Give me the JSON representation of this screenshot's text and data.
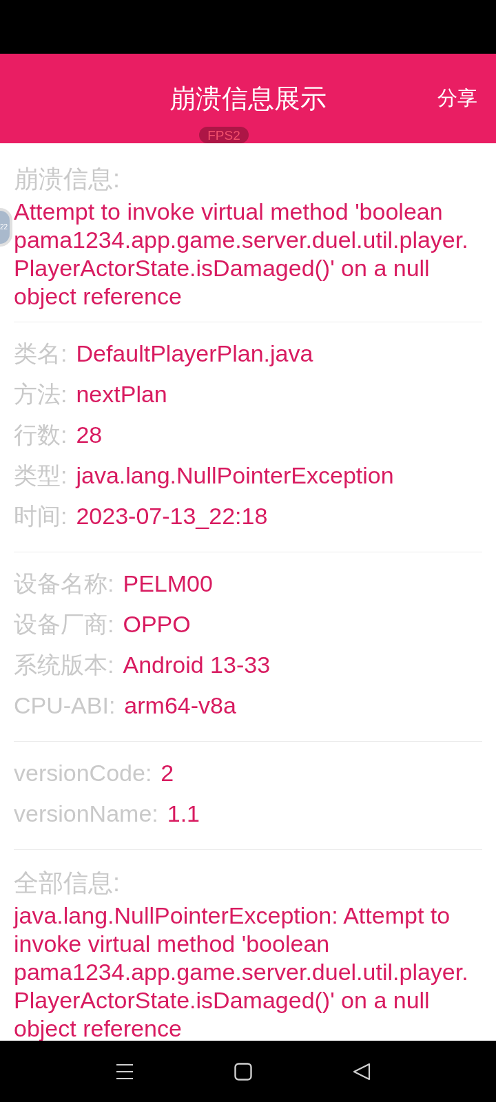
{
  "header": {
    "title": "崩溃信息展示",
    "action": "分享"
  },
  "fps_badge": "FPS2",
  "floating_ball": {
    "text": "22"
  },
  "crash_info": {
    "heading": "崩溃信息:",
    "text": "Attempt to invoke virtual method 'boolean pama1234.app.game.server.duel.util.player.PlayerActorState.isDamaged()' on a null object reference"
  },
  "detail_groups": [
    {
      "rows": [
        {
          "label": "类名:",
          "value": "DefaultPlayerPlan.java"
        },
        {
          "label": "方法:",
          "value": "nextPlan"
        },
        {
          "label": "行数:",
          "value": "28"
        },
        {
          "label": "类型:",
          "value": "java.lang.NullPointerException"
        },
        {
          "label": "时间:",
          "value": "2023-07-13_22:18"
        }
      ]
    },
    {
      "rows": [
        {
          "label": "设备名称:",
          "value": "PELM00"
        },
        {
          "label": "设备厂商:",
          "value": "OPPO"
        },
        {
          "label": "系统版本:",
          "value": "Android 13-33"
        },
        {
          "label": "CPU-ABI:",
          "value": "arm64-v8a"
        }
      ]
    },
    {
      "rows": [
        {
          "label": "versionCode:",
          "value": "2"
        },
        {
          "label": "versionName:",
          "value": "1.1"
        }
      ]
    }
  ],
  "full_info": {
    "heading": "全部信息:",
    "text": "java.lang.NullPointerException: Attempt to invoke virtual method 'boolean pama1234.app.game.server.duel.util.player.PlayerActorState.isDamaged()' on a null object reference"
  }
}
